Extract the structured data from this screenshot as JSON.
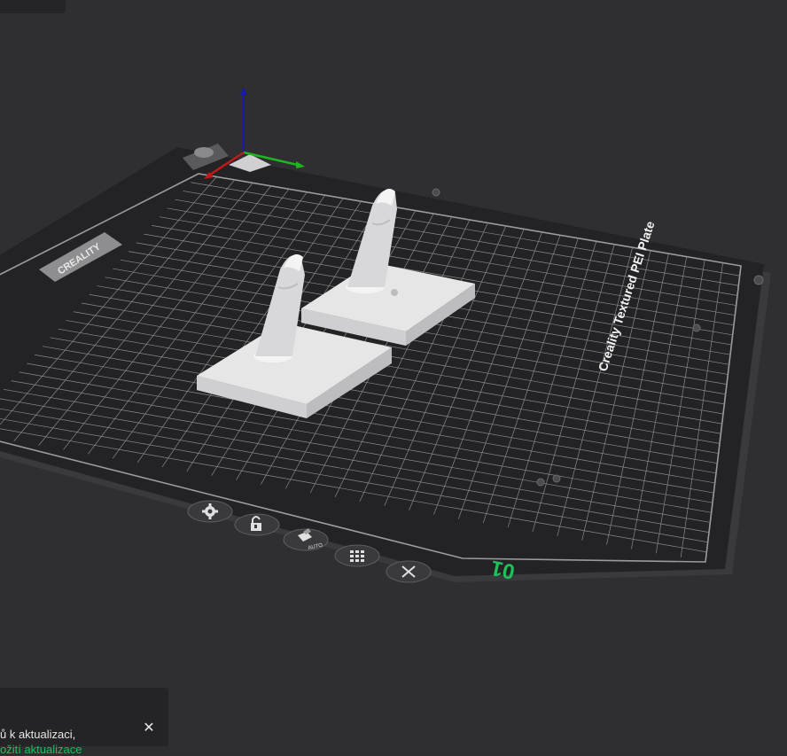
{
  "plate": {
    "brand_logo": "CREALITY",
    "plate_name": "Creality Textured PEI Plate",
    "plate_number": "01"
  },
  "plate_toolbar": [
    {
      "name": "plate-settings-button",
      "icon": "gear-icon"
    },
    {
      "name": "lock-plate-button",
      "icon": "lock-icon"
    },
    {
      "name": "auto-orient-button",
      "icon": "auto-orient-icon",
      "label": "AUTO"
    },
    {
      "name": "arrange-button",
      "icon": "arrange-grid-icon"
    },
    {
      "name": "delete-plate-button",
      "icon": "close-icon"
    }
  ],
  "notification": {
    "message": "ů k aktualizaci,",
    "link": "ožití aktualizace"
  },
  "colors": {
    "background": "#2f2f32",
    "plate": "#232325",
    "grid": "#8a8a8c",
    "model": "#e4e4e4",
    "plate_number": "#1fc15a",
    "axis_x": "#c01a1a",
    "axis_y": "#1fb51f",
    "axis_z": "#1a1aa8"
  }
}
